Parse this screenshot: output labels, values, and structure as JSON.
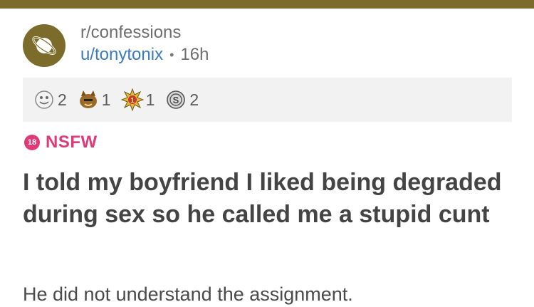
{
  "post": {
    "subreddit": "r/confessions",
    "username": "u/tonytonix",
    "separator": "•",
    "time_ago": "16h",
    "awards": [
      {
        "icon": "sticker-face-award-icon",
        "count": "2"
      },
      {
        "icon": "cat-face-award-icon",
        "count": "1"
      },
      {
        "icon": "gold-burst-award-icon",
        "count": "1"
      },
      {
        "icon": "silver-coin-award-icon",
        "count": "2"
      }
    ],
    "nsfw_badge": "18",
    "nsfw_label": "NSFW",
    "title": "I told my boyfriend I liked being degraded during sex so he called me a stupid cunt",
    "body": "He did not understand the assignment."
  },
  "colors": {
    "accent_bar": "#7b6c2c",
    "username": "#3b7bbd",
    "nsfw": "#e03a78",
    "award_strip": "#f2f2f2"
  }
}
